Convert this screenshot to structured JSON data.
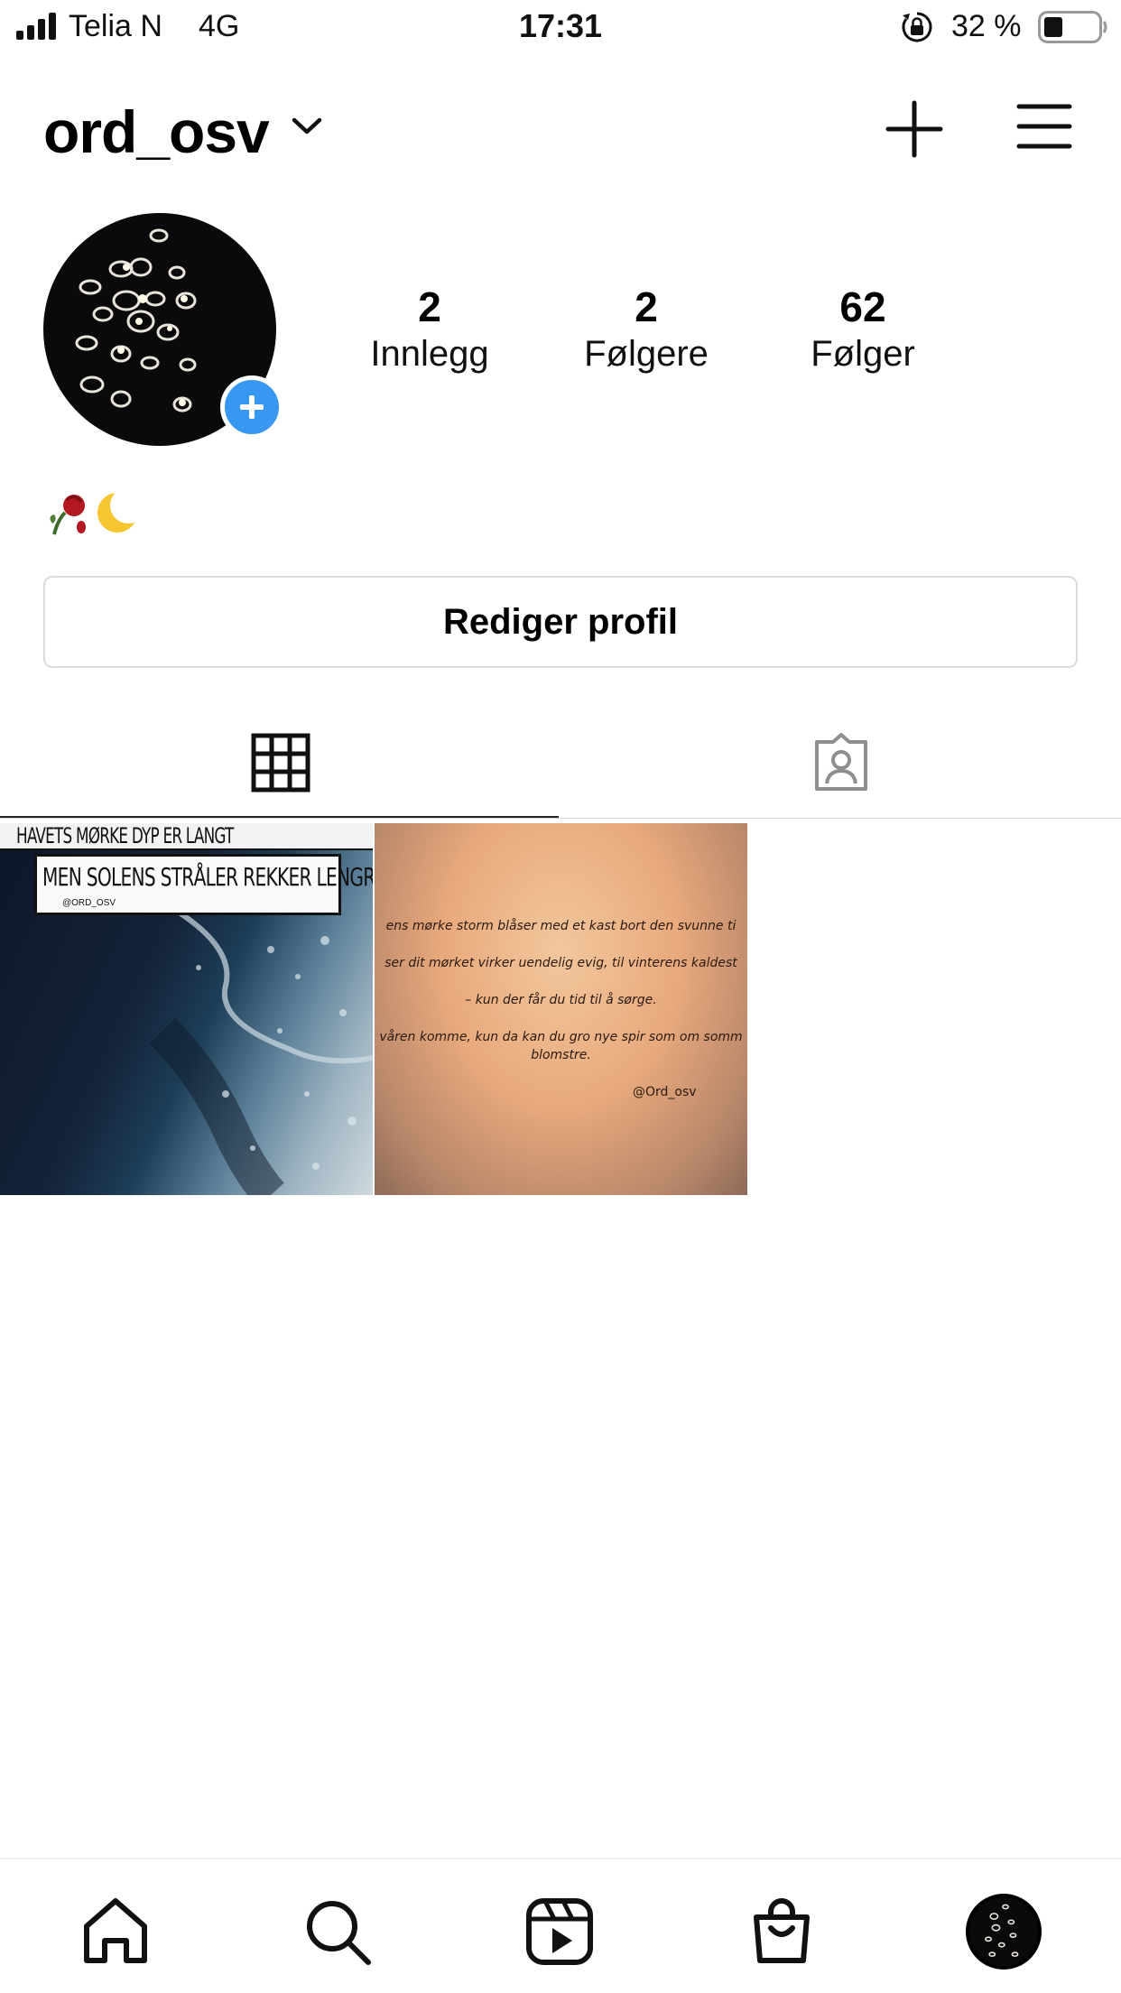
{
  "status_bar": {
    "carrier": "Telia N",
    "network": "4G",
    "time": "17:31",
    "battery_percent": "32 %",
    "icons": [
      "signal-bars-icon",
      "orientation-lock-icon",
      "battery-icon"
    ]
  },
  "header": {
    "username": "ord_osv",
    "icons": [
      "chevron-down-icon",
      "plus-icon",
      "menu-icon"
    ]
  },
  "profile": {
    "stats": [
      {
        "value": "2",
        "label": "Innlegg"
      },
      {
        "value": "2",
        "label": "Følgere"
      },
      {
        "value": "62",
        "label": "Følger"
      }
    ],
    "bio_icons": [
      "wilted-rose-emoji",
      "crescent-moon-emoji"
    ],
    "edit_button_label": "Rediger profil"
  },
  "tabs": {
    "icons": [
      "grid-icon",
      "tagged-person-icon"
    ],
    "active": "grid"
  },
  "posts": [
    {
      "line1": "HAVETS MØRKE DYP ER LANGT",
      "line2": "MEN SOLENS STRÅLER REKKER LENGRE",
      "handle": "@ORD_OSV"
    },
    {
      "lines": [
        "ens mørke storm blåser med et kast bort den svunne ti",
        "ser dit mørket virker uendelig evig, til vinterens kaldest",
        "– kun der får du tid til å sørge.",
        "våren komme, kun da kan du gro nye spir som om somm",
        "blomstre."
      ],
      "handle": "@Ord_osv"
    }
  ],
  "bottom_nav": {
    "icons": [
      "home-icon",
      "search-icon",
      "reels-icon",
      "shop-icon",
      "profile-avatar"
    ]
  },
  "colors": {
    "accent_blue": "#3897f0",
    "divider": "#dbdbdb",
    "text": "#000000"
  }
}
